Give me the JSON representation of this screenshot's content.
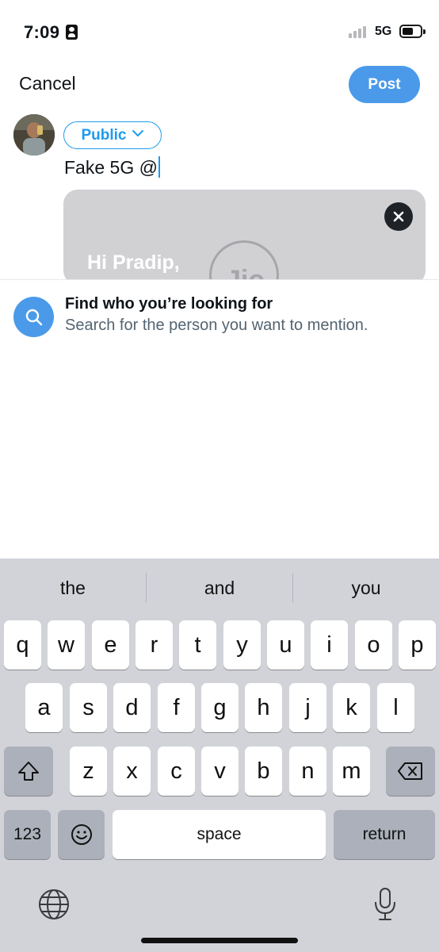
{
  "status_bar": {
    "time": "7:09",
    "network": "5G",
    "icons": [
      "contact-card-icon",
      "signal-icon",
      "battery-icon"
    ]
  },
  "compose": {
    "cancel_label": "Cancel",
    "post_label": "Post",
    "audience_label": "Public",
    "text": "Fake 5G @",
    "card": {
      "text": "Hi Pradip,",
      "logo_text": "Jio"
    }
  },
  "mention_suggestion": {
    "title": "Find who you’re looking for",
    "subtitle": "Search for the person you want to mention."
  },
  "keyboard": {
    "predictions": [
      "the",
      "and",
      "you"
    ],
    "row1": [
      "q",
      "w",
      "e",
      "r",
      "t",
      "y",
      "u",
      "i",
      "o",
      "p"
    ],
    "row2": [
      "a",
      "s",
      "d",
      "f",
      "g",
      "h",
      "j",
      "k",
      "l"
    ],
    "row3": [
      "z",
      "x",
      "c",
      "v",
      "b",
      "n",
      "m"
    ],
    "numbers_label": "123",
    "space_label": "space",
    "return_label": "return"
  },
  "colors": {
    "accent": "#1d9bf0",
    "post_button": "#4b9ae9",
    "keyboard_bg": "#d1d3d9"
  }
}
